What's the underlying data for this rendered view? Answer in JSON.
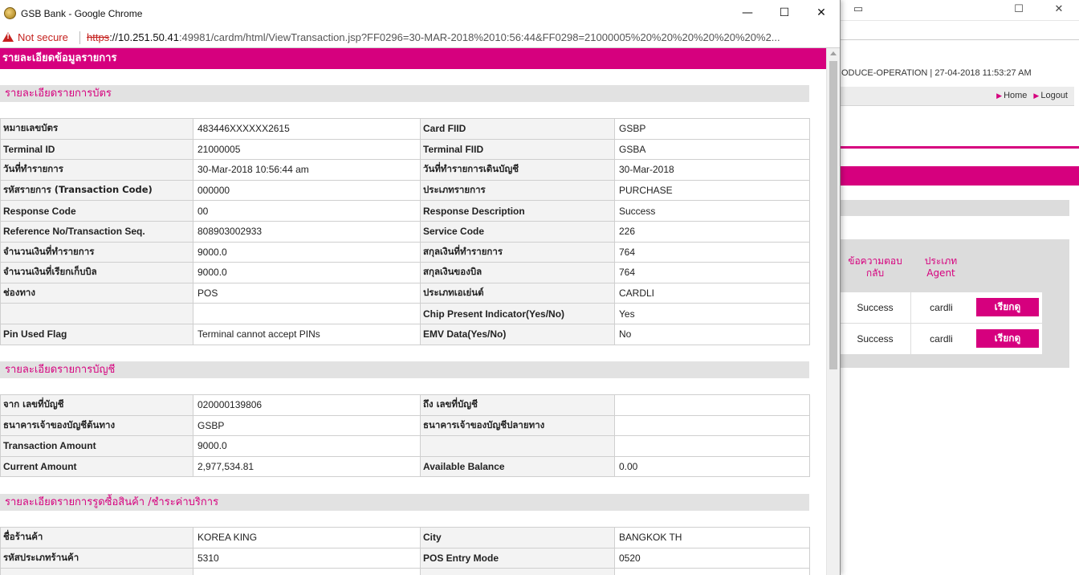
{
  "window": {
    "title": "GSB Bank - Google Chrome",
    "minimize": "—",
    "maximize": "☐",
    "close": "✕"
  },
  "address_bar": {
    "security_label": "Not secure",
    "url_scheme": "https",
    "url_host": "://10.251.50.41",
    "url_rest": ":49981/cardm/html/ViewTransaction.jsp?FF0296=30-MAR-2018%2010:56:44&FF0298=21000005%20%20%20%20%20%20%2..."
  },
  "page": {
    "header": "รายละเอียดข้อมูลรายการ",
    "sections": [
      {
        "title": "รายละเอียดรายการบัตร",
        "rows": [
          {
            "l1": "หมายเลขบัตร",
            "v1": "483446XXXXXX2615",
            "l2": "Card FIID",
            "v2": "GSBP"
          },
          {
            "l1": "Terminal ID",
            "v1": "21000005",
            "l2": "Terminal FIID",
            "v2": "GSBA"
          },
          {
            "l1": "วันที่ทำรายการ",
            "v1": "30-Mar-2018 10:56:44 am",
            "l2": "วันที่ทำรายการเดินบัญชี",
            "v2": "30-Mar-2018"
          },
          {
            "l1": "รหัสรายการ (Transaction Code)",
            "v1": "000000",
            "l2": "ประเภทรายการ",
            "v2": "PURCHASE"
          },
          {
            "l1": "Response Code",
            "v1": "00",
            "l2": "Response Description",
            "v2": "Success"
          },
          {
            "l1": "Reference No/Transaction Seq.",
            "v1": "808903002933",
            "l2": "Service Code",
            "v2": "226"
          },
          {
            "l1": "จำนวนเงินที่ทำรายการ",
            "v1": "9000.0",
            "l2": "สกุลเงินที่ทำรายการ",
            "v2": "764"
          },
          {
            "l1": "จำนวนเงินที่เรียกเก็บบิล",
            "v1": "9000.0",
            "l2": "สกุลเงินของบิล",
            "v2": "764"
          },
          {
            "l1": "ช่องทาง",
            "v1": "POS",
            "l2": "ประเภทเอเย่นต์",
            "v2": "CARDLI"
          },
          {
            "l1": "",
            "v1": "",
            "l2": "Chip Present Indicator(Yes/No)",
            "v2": "Yes"
          },
          {
            "l1": "Pin Used Flag",
            "v1": "Terminal cannot accept PINs",
            "l2": "EMV Data(Yes/No)",
            "v2": "No"
          }
        ]
      },
      {
        "title": "รายละเอียดรายการบัญชี",
        "rows": [
          {
            "l1": "จาก เลขที่บัญชี",
            "v1": "020000139806",
            "l2": "ถึง เลขที่บัญชี",
            "v2": ""
          },
          {
            "l1": "ธนาคารเจ้าของบัญชีต้นทาง",
            "v1": "GSBP",
            "l2": "ธนาคารเจ้าของบัญชีปลายทาง",
            "v2": ""
          },
          {
            "l1": "Transaction Amount",
            "v1": "9000.0",
            "l2": "",
            "v2": ""
          },
          {
            "l1": "Current Amount",
            "v1": "2,977,534.81",
            "l2": "Available Balance",
            "v2": "0.00"
          }
        ]
      },
      {
        "title": "รายละเอียดรายการรูดซื้อสินค้า /ชำระค่าบริการ",
        "rows": [
          {
            "l1": "ชื่อร้านค้า",
            "v1": "KOREA KING",
            "l2": "City",
            "v2": "BANGKOK TH"
          },
          {
            "l1": "รหัสประเภทร้านค้า",
            "v1": "5310",
            "l2": "POS Entry Mode",
            "v2": "0520"
          },
          {
            "l1": "",
            "v1": "",
            "l2": "",
            "v2": ""
          }
        ]
      }
    ]
  },
  "background_window": {
    "header_text": "ODUCE-OPERATION | 27-04-2018 11:53:27 AM",
    "nav_home": "Home",
    "nav_logout": "Logout",
    "col_response": "ข้อความตอบกลับ",
    "col_agent": "ประเภท Agent",
    "rows": [
      {
        "response": "Success",
        "agent": "cardli",
        "button": "เรียกดู"
      },
      {
        "response": "Success",
        "agent": "cardli",
        "button": "เรียกดู"
      }
    ]
  },
  "colors": {
    "brand_pink": "#d6007e",
    "section_gray": "#e2e2e2",
    "warning_red": "#c5221f"
  }
}
